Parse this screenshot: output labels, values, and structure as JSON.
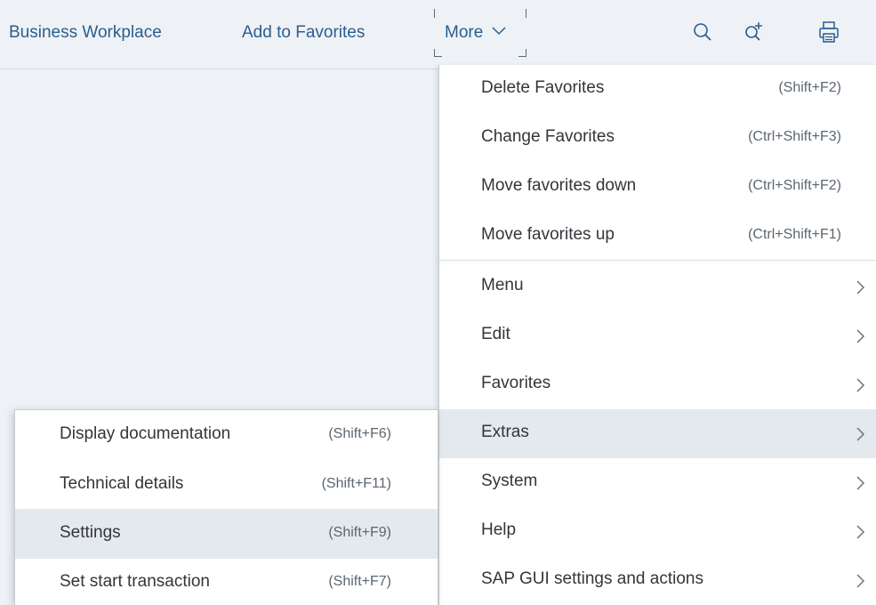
{
  "toolbar": {
    "business_workplace": "Business Workplace",
    "add_to_favorites": "Add to Favorites",
    "more": "More"
  },
  "menu": {
    "items": [
      {
        "label": "Delete Favorites",
        "shortcut": "(Shift+F2)"
      },
      {
        "label": "Change Favorites",
        "shortcut": "(Ctrl+Shift+F3)"
      },
      {
        "label": "Move favorites down",
        "shortcut": "(Ctrl+Shift+F2)"
      },
      {
        "label": "Move favorites up",
        "shortcut": "(Ctrl+Shift+F1)"
      },
      {
        "label": "Menu"
      },
      {
        "label": "Edit"
      },
      {
        "label": "Favorites"
      },
      {
        "label": "Extras"
      },
      {
        "label": "System"
      },
      {
        "label": "Help"
      },
      {
        "label": "SAP GUI settings and actions"
      }
    ]
  },
  "submenu": {
    "items": [
      {
        "label": "Display documentation",
        "shortcut": "(Shift+F6)"
      },
      {
        "label": "Technical details",
        "shortcut": "(Shift+F11)"
      },
      {
        "label": "Settings",
        "shortcut": "(Shift+F9)"
      },
      {
        "label": "Set start transaction",
        "shortcut": "(Shift+F7)"
      }
    ]
  },
  "icons": {
    "search": "search-icon",
    "search_add": "search-plus-icon",
    "print": "print-icon",
    "submenu_arrow": "chevron-right-icon",
    "more_chevron": "chevron-down-icon"
  },
  "colors": {
    "link": "#2a5d8f",
    "highlight": "#e4e9ee",
    "background": "#eef2f6"
  }
}
